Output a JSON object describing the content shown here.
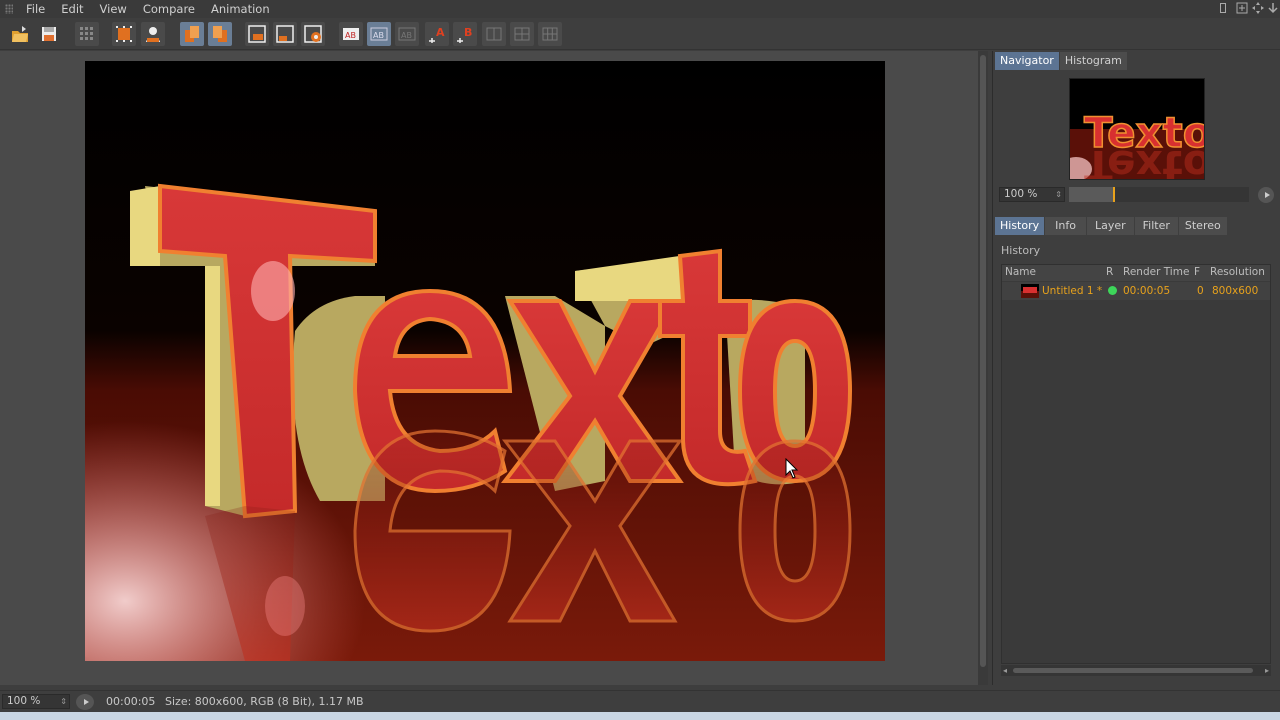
{
  "menubar": {
    "items": [
      "File",
      "Edit",
      "View",
      "Compare",
      "Animation"
    ]
  },
  "toolbar": {
    "buttons": [
      {
        "name": "open-image-icon"
      },
      {
        "name": "save-image-icon"
      },
      {
        "name": "grid-icon"
      },
      {
        "name": "crop-icon"
      },
      {
        "name": "user-icon"
      },
      {
        "name": "copy-left-icon",
        "active": true
      },
      {
        "name": "copy-right-icon",
        "active": true
      },
      {
        "name": "region-render-icon"
      },
      {
        "name": "region-render-alt-icon"
      },
      {
        "name": "render-settings-icon"
      },
      {
        "name": "compare-ab-icon"
      },
      {
        "name": "compare-ab-active-icon",
        "active": true
      },
      {
        "name": "compare-ab-dim-icon"
      },
      {
        "name": "set-a-icon"
      },
      {
        "name": "set-b-icon"
      },
      {
        "name": "split-1-icon"
      },
      {
        "name": "split-2-icon"
      },
      {
        "name": "split-3-icon"
      }
    ],
    "label_a": "A",
    "label_b": "B"
  },
  "render": {
    "text": "Texto"
  },
  "navigator": {
    "tabs": [
      "Navigator",
      "Histogram"
    ],
    "active_tab": "Navigator",
    "zoom": "100 %",
    "zoom_slider_value": 0.25
  },
  "panel": {
    "tabs": [
      "History",
      "Info",
      "Layer",
      "Filter",
      "Stereo"
    ],
    "active_tab": "History"
  },
  "history": {
    "title": "History",
    "columns": [
      "Name",
      "R",
      "Render Time",
      "F",
      "Resolution"
    ],
    "rows": [
      {
        "name": "Untitled 1 *",
        "render_time": "00:00:05",
        "frame": "0",
        "resolution": "800x600",
        "status_color": "#3dd65a"
      }
    ]
  },
  "status": {
    "zoom": "100 %",
    "time": "00:00:05",
    "info": "Size: 800x600, RGB (8 Bit), 1.17 MB"
  },
  "colors": {
    "accent": "#5c7493",
    "highlight": "#e8a21c"
  }
}
